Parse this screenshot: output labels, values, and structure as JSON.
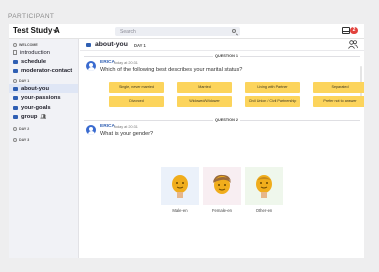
{
  "page_label": "PARTICIPANT",
  "header": {
    "study_title": "Test Study A",
    "search_placeholder": "Search",
    "notification_count": "2"
  },
  "sidebar": {
    "sections": [
      {
        "heading": "WELCOME",
        "items": [
          {
            "label": "introduction",
            "type": "doc"
          },
          {
            "label": "schedule",
            "type": "channel",
            "bold": true
          },
          {
            "label": "moderator-contact",
            "type": "channel",
            "bold": true
          }
        ]
      },
      {
        "heading": "DAY 1",
        "items": [
          {
            "label": "about-you",
            "type": "channel",
            "active": true
          },
          {
            "label": "your-passions",
            "type": "channel",
            "bold": true
          },
          {
            "label": "your-goals",
            "type": "channel",
            "bold": true
          },
          {
            "label": "group",
            "type": "channel",
            "group": true
          }
        ]
      },
      {
        "heading": "DAY 2",
        "items": []
      },
      {
        "heading": "DAY 3",
        "items": []
      }
    ]
  },
  "channel": {
    "title": "about-you",
    "day": "DAY 1"
  },
  "messages": [
    {
      "divider": "QUESTION 1",
      "sender": "ERICA",
      "timestamp": "Today at 20:31",
      "question": "Which of the following best describes your marital status?",
      "options": [
        "Single, never married",
        "Married",
        "Living with Partner",
        "Separated",
        "Divorced",
        "Widowed/Widower",
        "Civil Union / Civil Partnership",
        "Prefer not to answer"
      ]
    },
    {
      "divider": "QUESTION 2",
      "sender": "ERICA",
      "timestamp": "Today at 20:31",
      "question": "What is your gender?",
      "choices": [
        "Male-en",
        "Female-en",
        "Other-en"
      ]
    }
  ],
  "colors": {
    "accent": "#2f5fb3",
    "option_bg": "#fcd45c",
    "badge": "#e2423c"
  }
}
